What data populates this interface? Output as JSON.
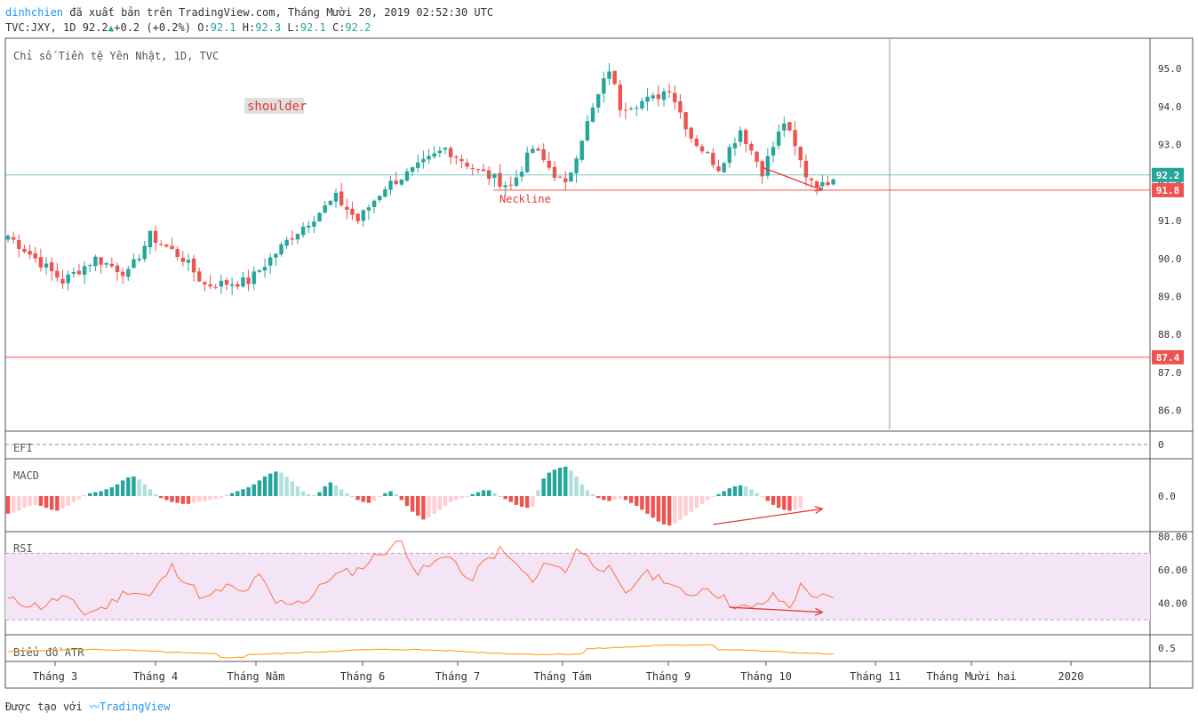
{
  "header": {
    "author": "dinhchien",
    "published": "đã xuất bản trên TradingView.com, Tháng Mười 20, 2019 02:52:30 UTC",
    "symbol": "TVC:JXY, 1D",
    "last": "92.2",
    "change": "+0.2 (+0.2%)",
    "o_label": "O:",
    "o_value": "92.1",
    "h_label": "H:",
    "h_value": "92.3",
    "l_label": "L:",
    "l_value": "92.1",
    "c_label": "C:",
    "c_value": "92.2"
  },
  "footer": {
    "made_with": "Được tạo với",
    "brand": "TradingView"
  },
  "colors": {
    "up": "#26a69a",
    "down": "#ef5350",
    "accent": "#2196f3",
    "rsi_band": "#f3e5f5",
    "line": "#ff9800"
  },
  "chart_data": {
    "type": "candlestick",
    "title": "Chỉ số Tiền tệ Yên Nhật, 1D, TVC",
    "x_labels": [
      "Tháng 3",
      "Tháng 4",
      "Tháng Năm",
      "Tháng 6",
      "Tháng 7",
      "Tháng Tám",
      "Tháng 9",
      "Tháng 10",
      "Tháng 11",
      "Tháng Mười hai",
      "2020"
    ],
    "y_ticks": [
      86.0,
      87.0,
      88.0,
      89.0,
      90.0,
      91.0,
      92.0,
      93.0,
      94.0,
      95.0
    ],
    "ylim": [
      85.5,
      95.8
    ],
    "levels": {
      "current": "92.2",
      "neckline": "91.8",
      "target": "87.4"
    },
    "annotations": {
      "shoulder": "shoulder",
      "neckline": "Neckline"
    },
    "anchors": [
      [
        0,
        90.6
      ],
      [
        10,
        89.4
      ],
      [
        16,
        90.0
      ],
      [
        22,
        89.6
      ],
      [
        26,
        90.6
      ],
      [
        32,
        90.0
      ],
      [
        36,
        89.3
      ],
      [
        44,
        89.4
      ],
      [
        52,
        90.6
      ],
      [
        60,
        91.6
      ],
      [
        64,
        91.0
      ],
      [
        69,
        91.9
      ],
      [
        74,
        92.3
      ],
      [
        80,
        92.9
      ],
      [
        86,
        92.3
      ],
      [
        92,
        91.9
      ],
      [
        96,
        92.9
      ],
      [
        102,
        91.9
      ],
      [
        105,
        93.2
      ],
      [
        110,
        95.0
      ],
      [
        112,
        94.0
      ],
      [
        118,
        94.2
      ],
      [
        121,
        94.5
      ],
      [
        125,
        93.2
      ],
      [
        130,
        92.4
      ],
      [
        134,
        93.4
      ],
      [
        138,
        92.3
      ],
      [
        142,
        93.6
      ],
      [
        146,
        92.2
      ],
      [
        149,
        91.9
      ],
      [
        151,
        92.2
      ]
    ],
    "indicators": {
      "efi": {
        "label": "EFI",
        "value_tick": "0"
      },
      "macd": {
        "label": "MACD",
        "value_tick": "0.0",
        "histogram": [
          -0.9,
          -0.85,
          -0.75,
          -0.6,
          -0.5,
          -0.45,
          -0.5,
          -0.6,
          -0.7,
          -0.75,
          -0.65,
          -0.5,
          -0.3,
          -0.15,
          0.05,
          0.15,
          0.2,
          0.25,
          0.35,
          0.45,
          0.6,
          0.8,
          0.95,
          1.0,
          0.85,
          0.6,
          0.35,
          0.1,
          -0.1,
          -0.2,
          -0.3,
          -0.35,
          -0.4,
          -0.4,
          -0.35,
          -0.3,
          -0.25,
          -0.2,
          -0.15,
          -0.1,
          0.05,
          0.15,
          0.25,
          0.35,
          0.45,
          0.6,
          0.8,
          1.0,
          1.15,
          1.25,
          1.2,
          1.0,
          0.75,
          0.5,
          0.25,
          0.1,
          0.05,
          0.2,
          0.5,
          0.7,
          0.55,
          0.35,
          0.15,
          0.0,
          -0.2,
          -0.3,
          -0.35,
          -0.25,
          -0.05,
          0.15,
          0.25,
          0.1,
          -0.2,
          -0.5,
          -0.8,
          -1.0,
          -1.2,
          -1.1,
          -0.9,
          -0.7,
          -0.5,
          -0.3,
          -0.2,
          -0.1,
          -0.05,
          0.1,
          0.2,
          0.3,
          0.3,
          0.15,
          0.0,
          -0.15,
          -0.3,
          -0.45,
          -0.55,
          -0.6,
          -0.55,
          0.3,
          0.9,
          1.2,
          1.35,
          1.45,
          1.5,
          1.3,
          1.0,
          0.6,
          0.3,
          0.1,
          -0.1,
          -0.2,
          -0.25,
          -0.2,
          -0.15,
          -0.2,
          -0.35,
          -0.5,
          -0.7,
          -0.9,
          -1.1,
          -1.3,
          -1.45,
          -1.5,
          -1.4,
          -1.2,
          -1.0,
          -0.8,
          -0.6,
          -0.4,
          -0.2,
          -0.05,
          0.1,
          0.25,
          0.4,
          0.5,
          0.55,
          0.5,
          0.35,
          0.15,
          -0.05,
          -0.25,
          -0.45,
          -0.6,
          -0.7,
          -0.75,
          -0.7,
          -0.6
        ]
      },
      "rsi": {
        "label": "RSI",
        "ticks": [
          40.0,
          60.0,
          80.0
        ],
        "band": [
          30,
          70
        ],
        "ylim": [
          22,
          82
        ],
        "anchors": [
          [
            0,
            42
          ],
          [
            6,
            38
          ],
          [
            10,
            44
          ],
          [
            14,
            34
          ],
          [
            18,
            38
          ],
          [
            22,
            48
          ],
          [
            26,
            44
          ],
          [
            30,
            62
          ],
          [
            33,
            52
          ],
          [
            36,
            42
          ],
          [
            40,
            50
          ],
          [
            43,
            46
          ],
          [
            46,
            56
          ],
          [
            49,
            40
          ],
          [
            55,
            42
          ],
          [
            59,
            56
          ],
          [
            64,
            60
          ],
          [
            68,
            70
          ],
          [
            72,
            77
          ],
          [
            75,
            58
          ],
          [
            78,
            64
          ],
          [
            81,
            70
          ],
          [
            84,
            52
          ],
          [
            87,
            64
          ],
          [
            90,
            72
          ],
          [
            94,
            60
          ],
          [
            96,
            52
          ],
          [
            99,
            66
          ],
          [
            102,
            58
          ],
          [
            104,
            74
          ],
          [
            107,
            64
          ],
          [
            110,
            60
          ],
          [
            113,
            44
          ],
          [
            116,
            58
          ],
          [
            120,
            55
          ],
          [
            124,
            44
          ],
          [
            128,
            50
          ],
          [
            132,
            40
          ],
          [
            136,
            36
          ],
          [
            140,
            44
          ],
          [
            143,
            38
          ],
          [
            145,
            50
          ],
          [
            148,
            44
          ],
          [
            151,
            42
          ]
        ]
      },
      "atr": {
        "label": "Biểu đồ ATR",
        "value_tick": "0.5"
      }
    },
    "divergence": {
      "price": [
        [
          138,
          92.4
        ],
        [
          149,
          91.8
        ]
      ],
      "macd": [
        [
          129,
          -1.45
        ],
        [
          149,
          -0.65
        ]
      ],
      "rsi": [
        [
          132,
          37.5
        ],
        [
          149,
          34.5
        ]
      ]
    }
  }
}
